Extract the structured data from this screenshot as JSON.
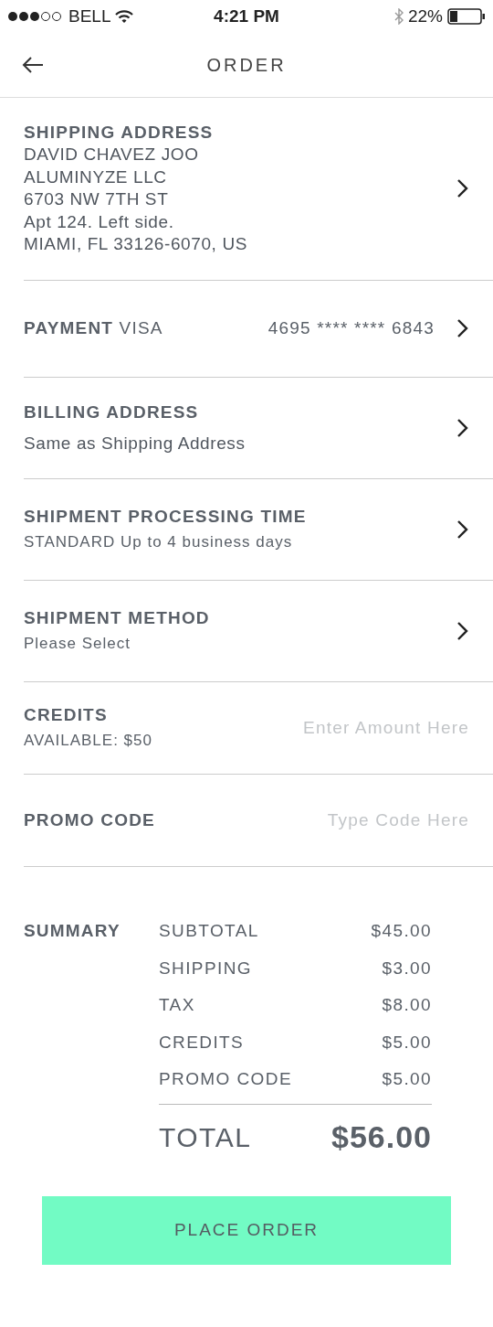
{
  "status_bar": {
    "carrier": "BELL",
    "time": "4:21 PM",
    "battery": "22%"
  },
  "header": {
    "title": "ORDER"
  },
  "sections": [
    {
      "kind": "address",
      "title": "SHIPPING ADDRESS",
      "lines": [
        "DAVID CHAVEZ JOO",
        "ALUMINYZE LLC",
        "6703 NW 7TH ST",
        "Apt 124. Left side.",
        "MIAMI, FL 33126-6070, US"
      ]
    },
    {
      "kind": "payment",
      "title": "PAYMENT",
      "value": "VISA",
      "number": "4695 **** **** 6843"
    },
    {
      "kind": "address",
      "title": "BILLING ADDRESS",
      "lines": [
        "Same as Shipping Address"
      ]
    },
    {
      "kind": "detail",
      "title": "SHIPMENT PROCESSING TIME",
      "subtitle": "STANDARD Up to 4 business days"
    },
    {
      "kind": "detail",
      "title": "SHIPMENT METHOD",
      "subtitle": "Please Select"
    },
    {
      "kind": "input",
      "title": "CREDITS",
      "subtitle": "AVAILABLE: $50",
      "placeholder": "Enter Amount Here"
    },
    {
      "kind": "input",
      "title": "PROMO CODE",
      "placeholder": "Type Code Here"
    }
  ],
  "summary": {
    "label": "SUMMARY",
    "rows": [
      {
        "label": "SUBTOTAL",
        "value": "$45.00"
      },
      {
        "label": "SHIPPING",
        "value": "$3.00"
      },
      {
        "label": "TAX",
        "value": "$8.00"
      },
      {
        "label": "CREDITS",
        "value": "$5.00"
      },
      {
        "label": "PROMO CODE",
        "value": "$5.00"
      }
    ],
    "total": {
      "label": "TOTAL",
      "value": "$56.00"
    }
  },
  "button": "PLACE ORDER"
}
